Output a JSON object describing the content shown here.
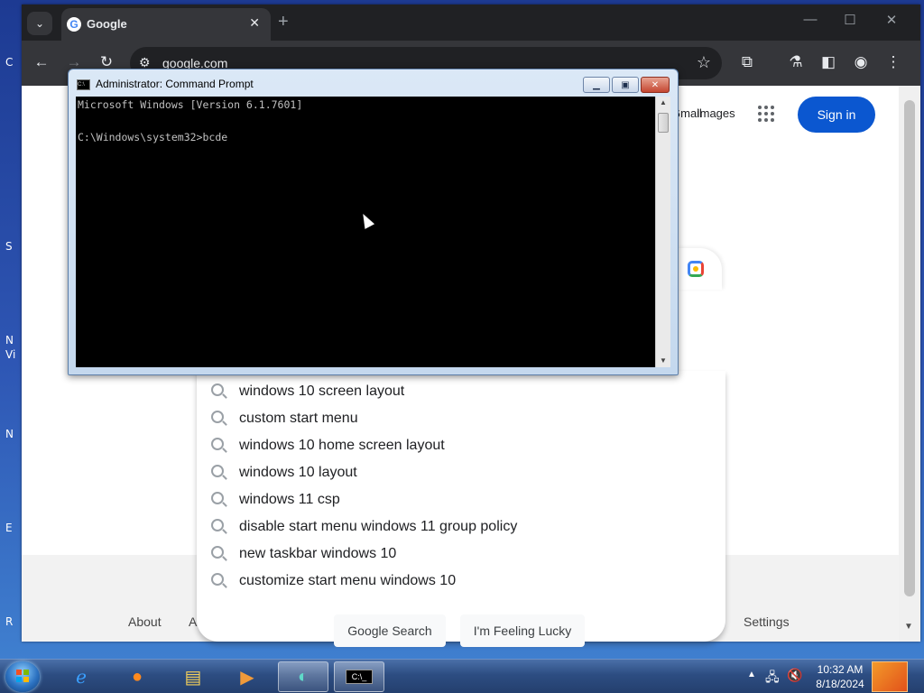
{
  "desktop": {
    "left_labels": [
      "C",
      "S",
      "N",
      "Vi",
      "N",
      "E",
      "R"
    ]
  },
  "browser": {
    "tab_title": "Google",
    "url": "google.com",
    "header_links": [
      "Gmail",
      "Images"
    ],
    "sign_in_label": "Sign in",
    "suggestions": [
      "windows 10 screen layout",
      "custom start menu",
      "windows 10 home screen layout",
      "windows 10 layout",
      "windows 11 csp",
      "disable start menu windows 11 group policy",
      "new taskbar windows 10",
      "customize start menu windows 10"
    ],
    "search_button_label": "Google Search",
    "lucky_button_label": "I'm Feeling Lucky",
    "footer_links": {
      "about": "About",
      "advertising": "A",
      "settings": "Settings"
    }
  },
  "cmd": {
    "title": "Administrator: Command Prompt",
    "lines": [
      "Microsoft Windows [Version 6.1.7601]",
      "",
      "C:\\Windows\\system32>bcde"
    ]
  },
  "taskbar": {
    "clock_time": "10:32 AM",
    "clock_date": "8/18/2024"
  }
}
